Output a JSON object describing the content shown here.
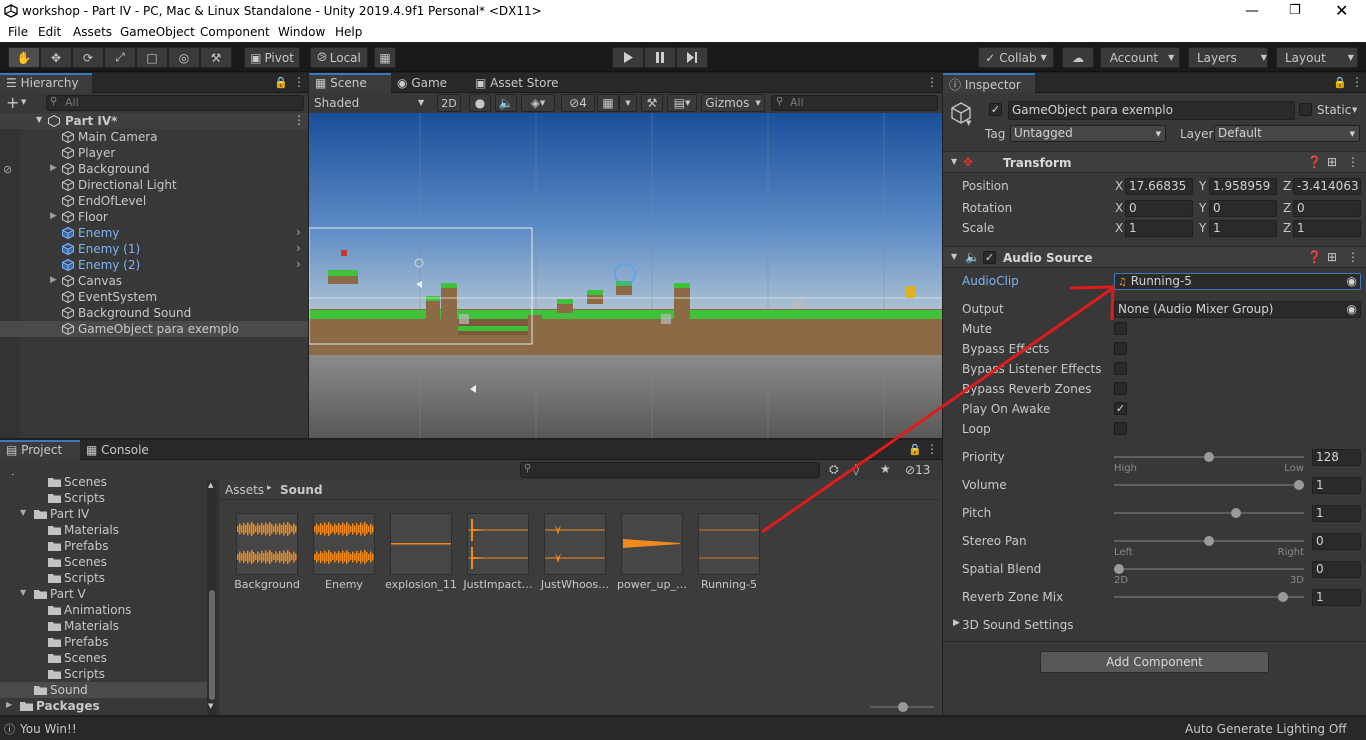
{
  "window": {
    "title": "workshop - Part IV - PC, Mac & Linux Standalone - Unity 2019.4.9f1 Personal* <DX11>"
  },
  "menu": [
    "File",
    "Edit",
    "Assets",
    "GameObject",
    "Component",
    "Window",
    "Help"
  ],
  "toolbar": {
    "pivot": "Pivot",
    "local": "Local",
    "collab": "Collab",
    "account": "Account",
    "layers": "Layers",
    "layout": "Layout"
  },
  "hierarchy": {
    "tab": "Hierarchy",
    "search_placeholder": "All",
    "scene": "Part IV*",
    "items": [
      {
        "label": "Main Camera",
        "prefab": false,
        "foldout": false
      },
      {
        "label": "Player",
        "prefab": false,
        "foldout": false
      },
      {
        "label": "Background",
        "prefab": false,
        "foldout": true
      },
      {
        "label": "Directional Light",
        "prefab": false,
        "foldout": false
      },
      {
        "label": "EndOfLevel",
        "prefab": false,
        "foldout": false
      },
      {
        "label": "Floor",
        "prefab": false,
        "foldout": true
      },
      {
        "label": "Enemy",
        "prefab": true,
        "foldout": false
      },
      {
        "label": "Enemy (1)",
        "prefab": true,
        "foldout": false
      },
      {
        "label": "Enemy (2)",
        "prefab": true,
        "foldout": false
      },
      {
        "label": "Canvas",
        "prefab": false,
        "foldout": true
      },
      {
        "label": "EventSystem",
        "prefab": false,
        "foldout": false
      },
      {
        "label": "Background Sound",
        "prefab": false,
        "foldout": false
      },
      {
        "label": "GameObject para exemplo",
        "prefab": false,
        "foldout": false,
        "selected": true
      }
    ]
  },
  "scene_view": {
    "tabs": [
      "Scene",
      "Game",
      "Asset Store"
    ],
    "shading": "Shaded",
    "mode_2d": "2D",
    "hidden_count": "4",
    "gizmos": "Gizmos",
    "search_placeholder": "All"
  },
  "project": {
    "tabs": [
      "Project",
      "Console"
    ],
    "tree": [
      {
        "label": "Scenes",
        "depth": 2,
        "type": "folder"
      },
      {
        "label": "Scripts",
        "depth": 2,
        "type": "folder"
      },
      {
        "label": "Part IV",
        "depth": 1,
        "type": "open"
      },
      {
        "label": "Materials",
        "depth": 2,
        "type": "folder"
      },
      {
        "label": "Prefabs",
        "depth": 2,
        "type": "folder"
      },
      {
        "label": "Scenes",
        "depth": 2,
        "type": "folder"
      },
      {
        "label": "Scripts",
        "depth": 2,
        "type": "folder"
      },
      {
        "label": "Part V",
        "depth": 1,
        "type": "open"
      },
      {
        "label": "Animations",
        "depth": 2,
        "type": "folder"
      },
      {
        "label": "Materials",
        "depth": 2,
        "type": "folder"
      },
      {
        "label": "Prefabs",
        "depth": 2,
        "type": "folder"
      },
      {
        "label": "Scenes",
        "depth": 2,
        "type": "folder"
      },
      {
        "label": "Scripts",
        "depth": 2,
        "type": "folder"
      },
      {
        "label": "Sound",
        "depth": 1,
        "type": "folder",
        "selected": true
      },
      {
        "label": "Packages",
        "depth": 0,
        "type": "closed",
        "bold": true
      }
    ],
    "breadcrumb_root": "Assets",
    "breadcrumb_current": "Sound",
    "hidden_count": "13",
    "assets": [
      "Background",
      "Enemy",
      "explosion_11",
      "JustImpact…",
      "JustWhoos…",
      "power_up_…",
      "Running-5"
    ]
  },
  "inspector": {
    "tab": "Inspector",
    "object_name": "GameObject para exemplo",
    "static_label": "Static",
    "tag_label": "Tag",
    "tag_value": "Untagged",
    "layer_label": "Layer",
    "layer_value": "Default",
    "transform": {
      "title": "Transform",
      "position": {
        "label": "Position",
        "x": "17.66835",
        "y": "1.958959",
        "z": "-3.414063"
      },
      "rotation": {
        "label": "Rotation",
        "x": "0",
        "y": "0",
        "z": "0"
      },
      "scale": {
        "label": "Scale",
        "x": "1",
        "y": "1",
        "z": "1"
      }
    },
    "audio_source": {
      "title": "Audio Source",
      "audioclip_label": "AudioClip",
      "audioclip_value": "Running-5",
      "output_label": "Output",
      "output_value": "None (Audio Mixer Group)",
      "mute": "Mute",
      "bypass_effects": "Bypass Effects",
      "bypass_listener": "Bypass Listener Effects",
      "bypass_reverb": "Bypass Reverb Zones",
      "play_on_awake": "Play On Awake",
      "loop": "Loop",
      "priority": {
        "label": "Priority",
        "value": "128",
        "min_label": "High",
        "max_label": "Low",
        "fraction": 0.5
      },
      "volume": {
        "label": "Volume",
        "value": "1",
        "fraction": 1.0
      },
      "pitch": {
        "label": "Pitch",
        "value": "1",
        "fraction": 0.65
      },
      "stereo_pan": {
        "label": "Stereo Pan",
        "value": "0",
        "min_label": "Left",
        "max_label": "Right",
        "fraction": 0.5
      },
      "spatial_blend": {
        "label": "Spatial Blend",
        "value": "0",
        "min_label": "2D",
        "max_label": "3D",
        "fraction": 0.0
      },
      "reverb_zone_mix": {
        "label": "Reverb Zone Mix",
        "value": "1",
        "fraction": 0.91
      },
      "sound_3d": "3D Sound Settings"
    },
    "add_component": "Add Component"
  },
  "status": {
    "message": "You Win!!",
    "lighting": "Auto Generate Lighting Off"
  },
  "colors": {
    "selection": "#3a79bb",
    "prefab_text": "#7cb5f5",
    "annotation_arrow": "#e01b1b",
    "waveform": "#f08a1c"
  }
}
